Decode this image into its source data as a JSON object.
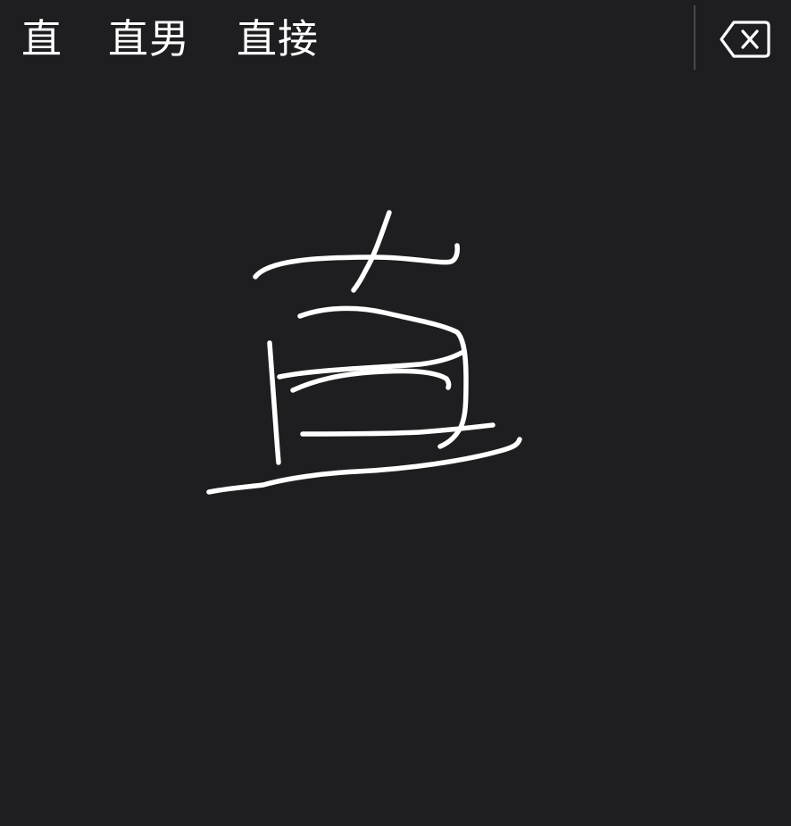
{
  "candidates": [
    {
      "text": "直"
    },
    {
      "text": "直男"
    },
    {
      "text": "直接"
    }
  ],
  "icons": {
    "delete": "backspace-icon"
  },
  "colors": {
    "background": "#1e1d20",
    "ink": "#ffffff",
    "divider": "#4a494d"
  }
}
